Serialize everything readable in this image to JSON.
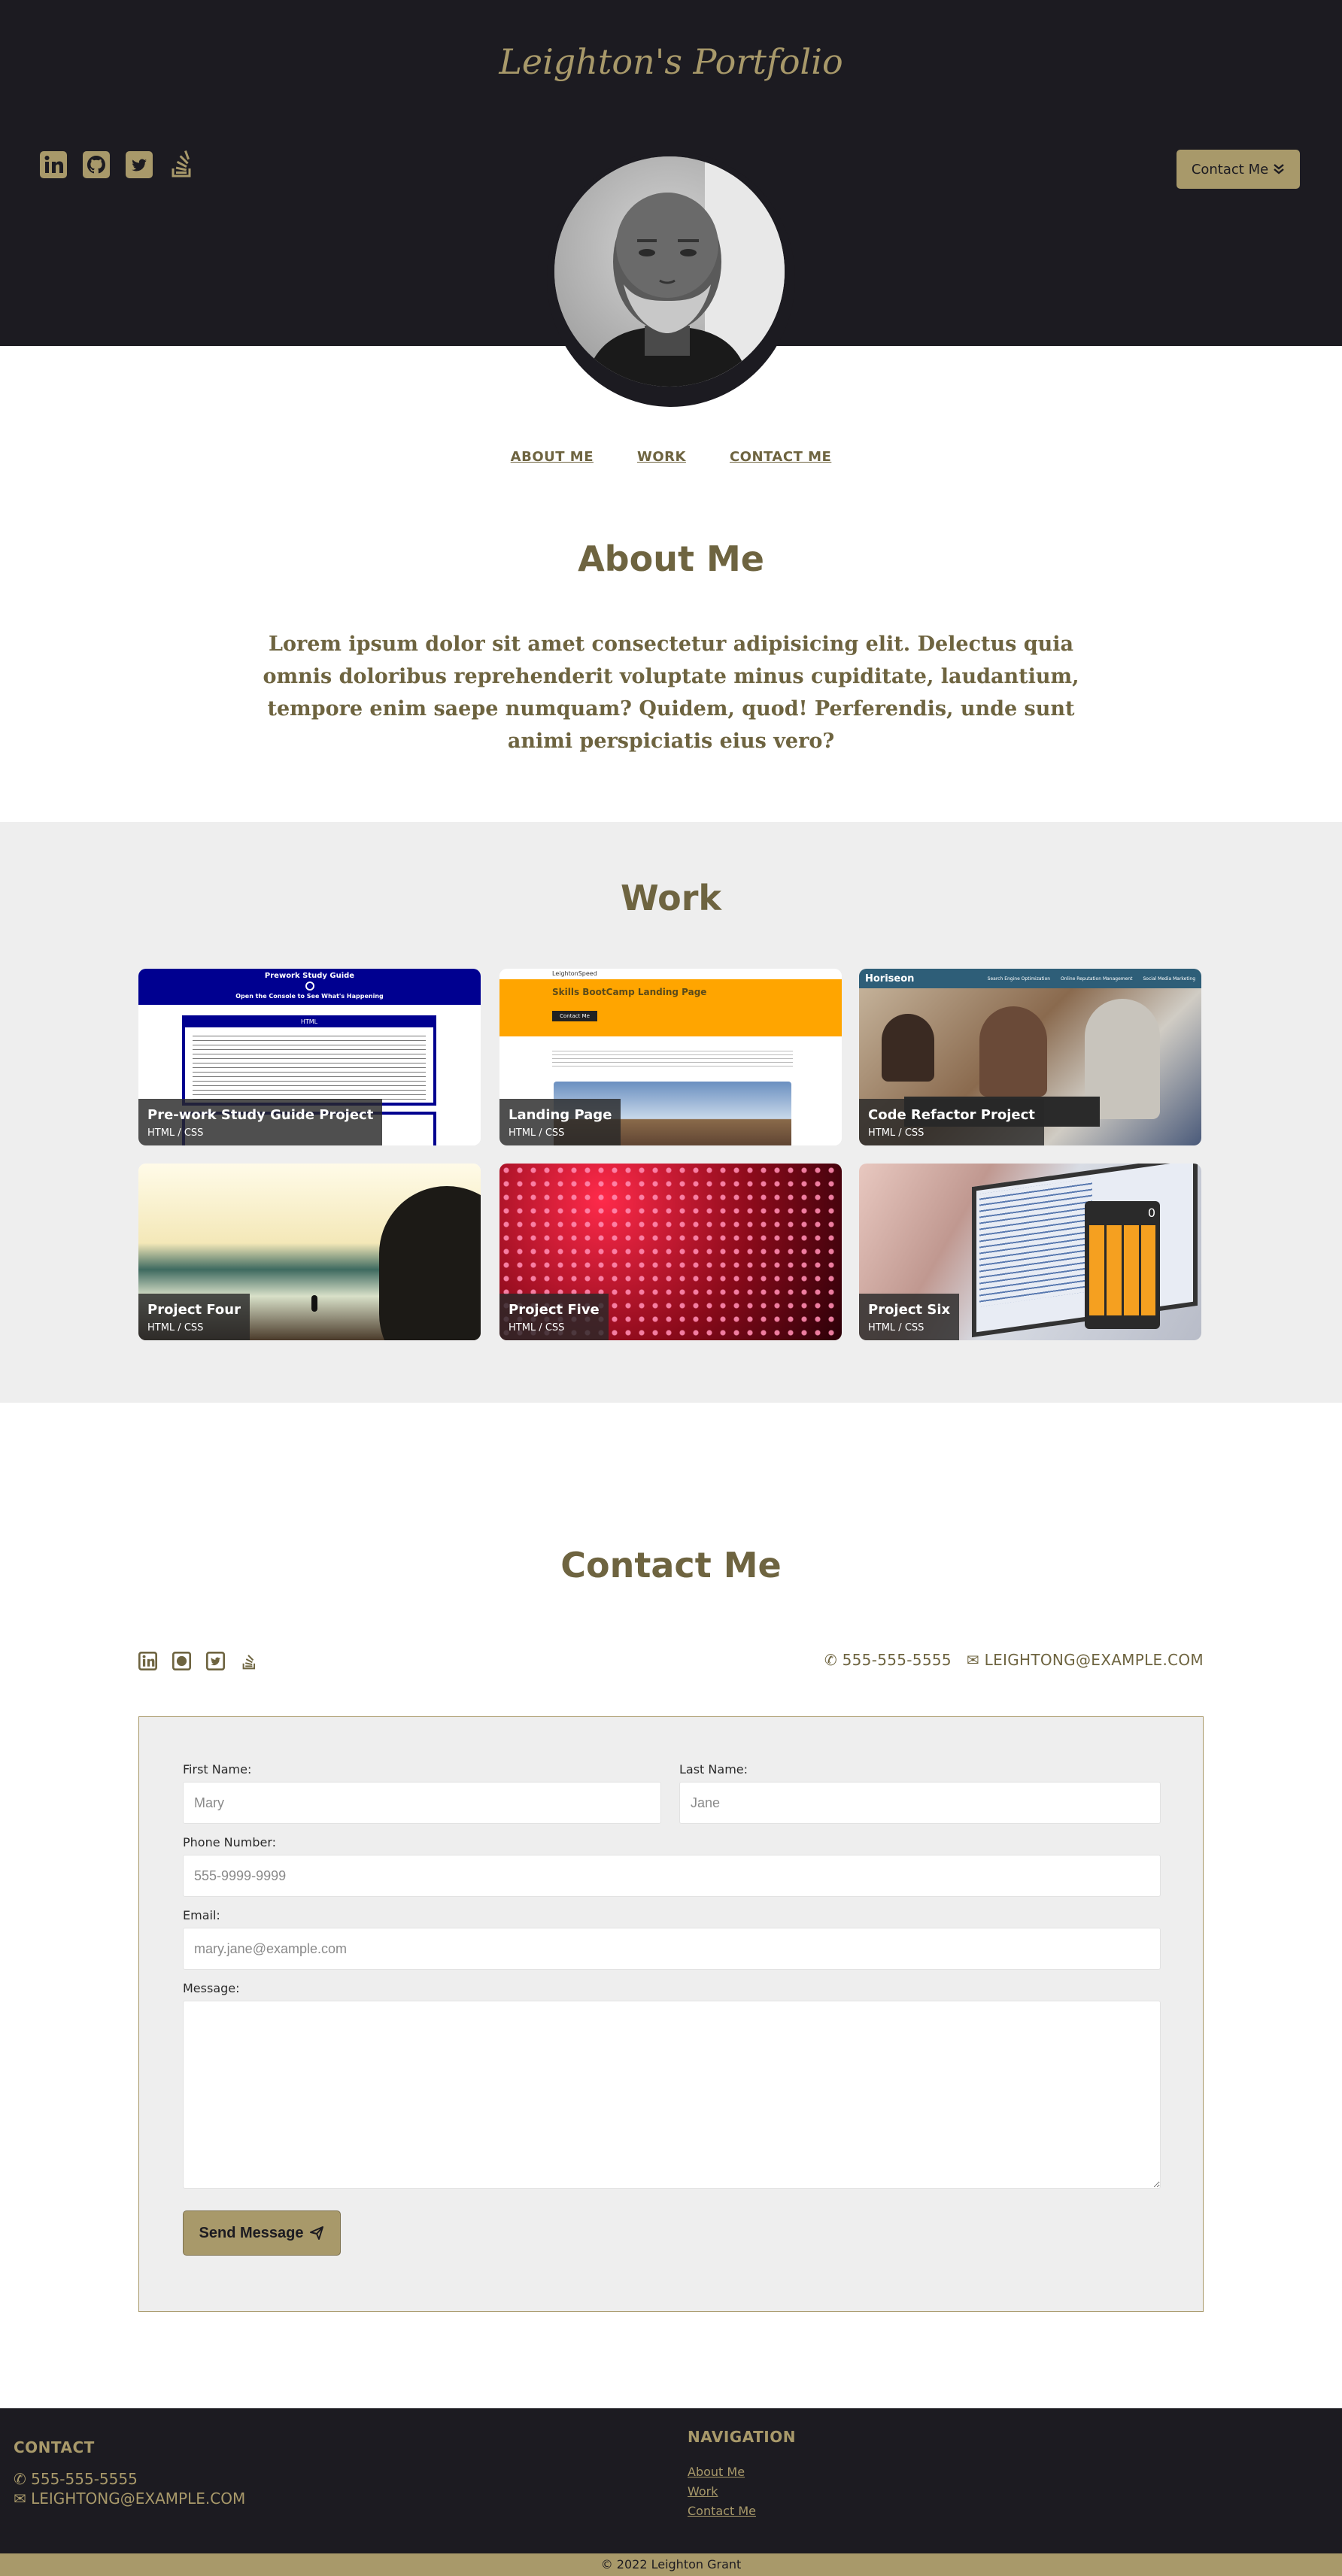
{
  "header": {
    "brand": "Leighton's Portfolio",
    "contact_button": "Contact Me",
    "social_icons": [
      "linkedin-icon",
      "github-icon",
      "twitter-icon",
      "stackoverflow-icon"
    ]
  },
  "nav": {
    "about": "ABOUT ME",
    "work": "WORK",
    "contact": "CONTACT ME"
  },
  "about": {
    "title": "About Me",
    "text": "Lorem ipsum dolor sit amet consectetur adipisicing elit. Delectus quia omnis doloribus reprehenderit voluptate minus cupiditate, laudantium, tempore enim saepe numquam? Quidem, quod! Perferendis, unde sunt animi perspiciatis eius vero?"
  },
  "work": {
    "title": "Work",
    "projects": [
      {
        "title": "Pre-work Study Guide Project",
        "tech": "HTML / CSS",
        "thumb_heading": "Prework Study Guide",
        "thumb_sub": "Open the Console to See What's Happening",
        "thumb_box": "HTML"
      },
      {
        "title": "Landing Page",
        "tech": "HTML / CSS",
        "thumb_brand": "LeightonSpeed",
        "thumb_heading": "Skills BootCamp Landing Page",
        "thumb_button": "Contact Me"
      },
      {
        "title": "Code Refactor Project",
        "tech": "HTML / CSS",
        "thumb_brand": "Horiseon",
        "thumb_nav": [
          "Search Engine Optimization",
          "Online Reputation Management",
          "Social Media Marketing"
        ]
      },
      {
        "title": "Project Four",
        "tech": "HTML / CSS"
      },
      {
        "title": "Project Five",
        "tech": "HTML / CSS"
      },
      {
        "title": "Project Six",
        "tech": "HTML / CSS",
        "thumb_value": "0"
      }
    ]
  },
  "contact": {
    "title": "Contact Me",
    "phone": "555-555-5555",
    "email": "LEIGHTONG@EXAMPLE.COM",
    "form": {
      "first_name_label": "First Name:",
      "first_name_placeholder": "Mary",
      "last_name_label": "Last Name:",
      "last_name_placeholder": "Jane",
      "phone_label": "Phone Number:",
      "phone_placeholder": "555-9999-9999",
      "email_label": "Email:",
      "email_placeholder": "mary.jane@example.com",
      "message_label": "Message:",
      "message_placeholder": "",
      "send_button": "Send Message"
    }
  },
  "footer": {
    "contact_heading": "CONTACT",
    "phone": "555-555-5555",
    "email": "LEIGHTONG@EXAMPLE.COM",
    "nav_heading": "NAVIGATION",
    "links": [
      "About Me",
      "Work",
      "Contact Me"
    ],
    "copyright": "© 2022 Leighton Grant"
  },
  "colors": {
    "dark": "#1c1b21",
    "accent": "#a8996a",
    "text": "#6e6440",
    "panel": "#eeeeee"
  }
}
